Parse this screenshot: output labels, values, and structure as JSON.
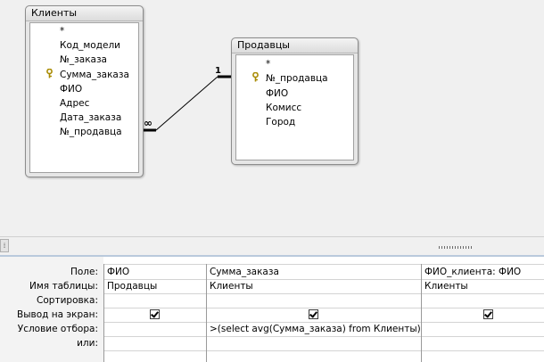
{
  "diagram": {
    "table_clients": {
      "title": "Клиенты",
      "fields": [
        "*",
        "Код_модели",
        "№_заказа",
        "Сумма_заказа",
        "ФИО",
        "Адрес",
        "Дата_заказа",
        "№_продавца"
      ],
      "key_field": "№_заказа"
    },
    "table_sellers": {
      "title": "Продавцы",
      "fields": [
        "*",
        "№_продавца",
        "ФИО",
        "Комисс",
        "Город"
      ],
      "key_field": "№_продавца"
    },
    "relationship": {
      "one_label": "1",
      "many_label": "∞"
    }
  },
  "grid": {
    "row_labels": {
      "field": "Поле:",
      "table": "Имя таблицы:",
      "sort": "Сортировка:",
      "show": "Вывод на экран:",
      "criteria": "Условие отбора:",
      "or": "или:"
    },
    "columns": [
      {
        "field": "ФИО",
        "table": "Продавцы",
        "sort": "",
        "show": true,
        "criteria": "",
        "or": ""
      },
      {
        "field": "Сумма_заказа",
        "table": "Клиенты",
        "sort": "",
        "show": true,
        "criteria": ">(select avg(Сумма_заказа) from Клиенты)",
        "or": ""
      },
      {
        "field": "ФИО_клиента: ФИО",
        "table": "Клиенты",
        "sort": "",
        "show": true,
        "criteria": "",
        "or": ""
      }
    ]
  },
  "icons": {
    "key": "key-icon",
    "checkbox": "checkbox-checked-icon"
  },
  "colors": {
    "splitter_bar": "#b9c9dc",
    "pane_bg": "#f0f0f0"
  }
}
